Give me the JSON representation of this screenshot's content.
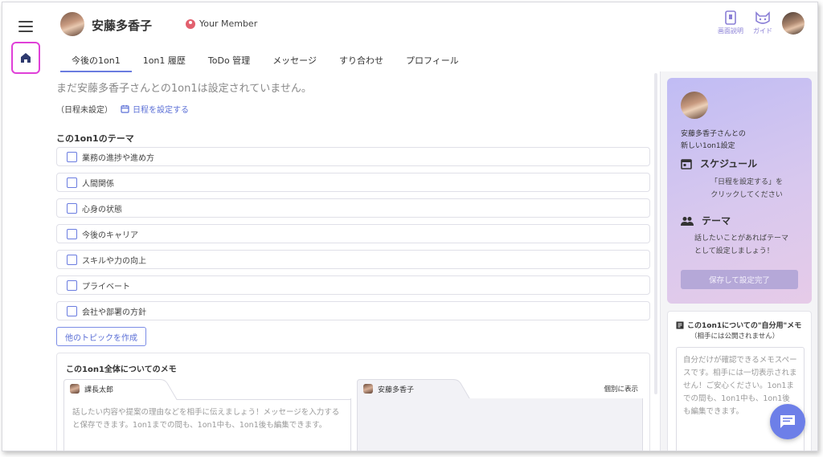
{
  "header": {
    "user_name": "安藤多香子",
    "member_label": "Your Member",
    "tools": [
      {
        "label": "画面説明",
        "icon": "phone-guide-icon"
      },
      {
        "label": "ガイド",
        "icon": "cat-guide-icon"
      }
    ]
  },
  "tabs": [
    {
      "label": "今後の1on1",
      "active": true
    },
    {
      "label": "1on1 履歴",
      "active": false
    },
    {
      "label": "ToDo 管理",
      "active": false
    },
    {
      "label": "メッセージ",
      "active": false
    },
    {
      "label": "すり合わせ",
      "active": false
    },
    {
      "label": "プロフィール",
      "active": false
    }
  ],
  "main": {
    "notice": "まだ安藤多香子さんとの1on1は設定されていません。",
    "no_schedule": "（日程未設定）",
    "set_schedule_link": "日程を設定する",
    "theme_title": "この1on1のテーマ",
    "themes": [
      "業務の進捗や進め方",
      "人間関係",
      "心身の状態",
      "今後のキャリア",
      "スキルや力の向上",
      "プライベート",
      "会社や部署の方針"
    ],
    "add_topic_button": "他のトピックを作成",
    "memo_title": "この1on1全体についてのメモ",
    "memo_left_name": "課長太郎",
    "memo_left_placeholder": "話したい内容や提案の理由などを相手に伝えましょう！メッセージを入力すると保存できます。1on1までの間も、1on1中も、1on1後も編集できます。",
    "memo_right_name": "安藤多香子",
    "individual_toggle": "個別に表示"
  },
  "guide": {
    "intro_line1": "安藤多香子さんとの",
    "intro_line2": "新しい1on1設定",
    "schedule_heading": "スケジュール",
    "schedule_line1": "「日程を設定する」を",
    "schedule_line2": "クリックしてください",
    "theme_heading": "テーマ",
    "theme_line1": "話したいことがあればテーマ",
    "theme_line2": "として設定しましょう！",
    "save_button": "保存して設定完了"
  },
  "self_memo": {
    "title": "この1on1についての\"自分用\"メモ",
    "subtitle": "（相手には公開されません）",
    "placeholder": "自分だけが確認できるメモスペースです。相手には一切表示されません！ご安心ください。1on1までの間も、1on1中も、1on1後も編集できます。"
  },
  "colors": {
    "accent": "#6a7ce0",
    "highlight": "#e040d8",
    "guide_gradient_start": "#c0bcf4",
    "guide_gradient_end": "#e6cbe8",
    "fab": "#6d7fe8"
  }
}
